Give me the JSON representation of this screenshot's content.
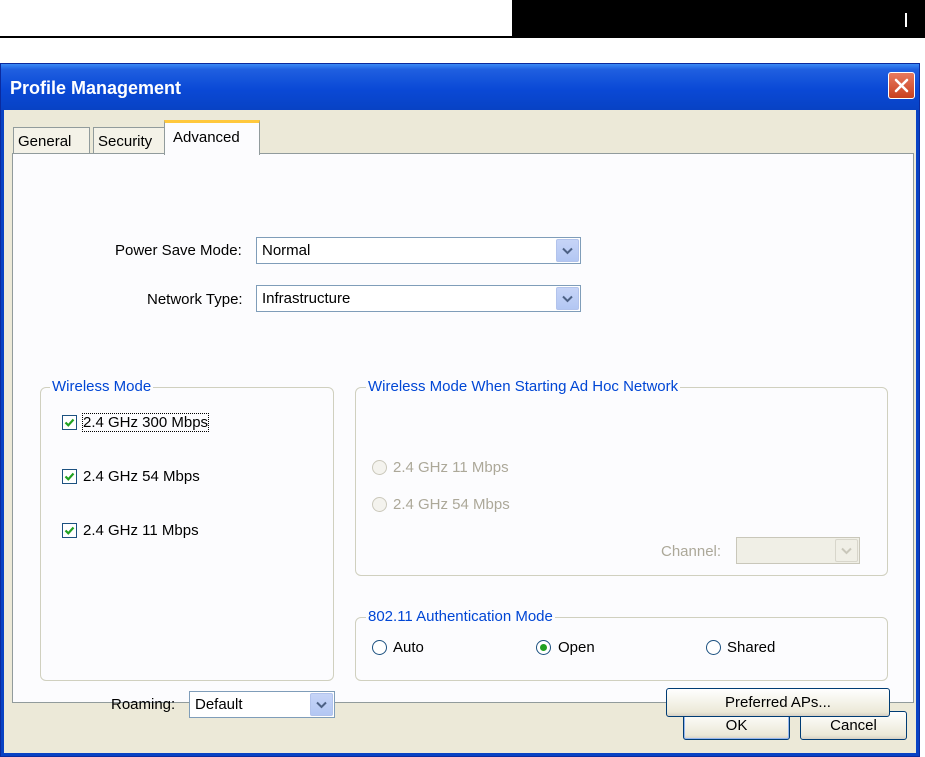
{
  "window": {
    "title": "Profile Management"
  },
  "tabs": [
    {
      "label": "General"
    },
    {
      "label": "Security"
    },
    {
      "label": "Advanced",
      "active": true
    }
  ],
  "power_save": {
    "label": "Power Save Mode:",
    "value": "Normal"
  },
  "network_type": {
    "label": "Network Type:",
    "value": "Infrastructure"
  },
  "wireless_mode": {
    "title": "Wireless Mode",
    "options": [
      {
        "label": "2.4 GHz 300 Mbps",
        "checked": true
      },
      {
        "label": "2.4 GHz 54 Mbps",
        "checked": true
      },
      {
        "label": "2.4 GHz 11 Mbps",
        "checked": true
      }
    ]
  },
  "adhoc": {
    "title": "Wireless Mode When Starting Ad Hoc Network",
    "options": [
      {
        "label": "2.4 GHz 11 Mbps",
        "selected": false,
        "enabled": false
      },
      {
        "label": "2.4 GHz 54 Mbps",
        "selected": false,
        "enabled": false
      }
    ],
    "channel_label": "Channel:",
    "channel_value": ""
  },
  "auth_mode": {
    "title": "802.11 Authentication Mode",
    "options": [
      {
        "label": "Auto",
        "selected": false
      },
      {
        "label": "Open",
        "selected": true
      },
      {
        "label": "Shared",
        "selected": false
      }
    ]
  },
  "roaming": {
    "label": "Roaming:",
    "value": "Default"
  },
  "buttons": {
    "preferred_aps": "Preferred APs...",
    "ok": "OK",
    "cancel": "Cancel"
  },
  "colors": {
    "title_bar": "#0a49d6",
    "window_bg": "#ece9d8",
    "group_title": "#0046d5",
    "tab_highlight": "#ffc83c"
  },
  "icons": {
    "close": "close-icon",
    "dropdown": "chevron-down-icon",
    "check": "checkmark-icon",
    "radio_dot": "radio-dot-icon"
  }
}
